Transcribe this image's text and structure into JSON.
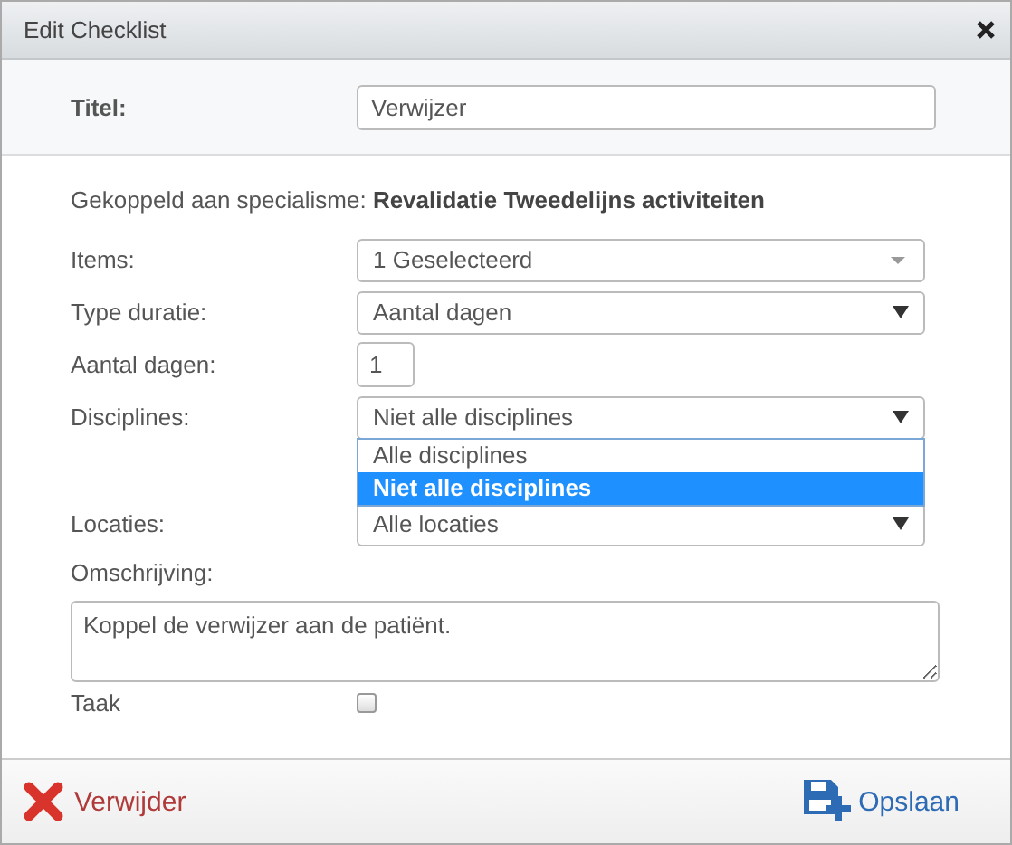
{
  "window": {
    "title": "Edit Checklist"
  },
  "title_field": {
    "label": "Titel:",
    "value": "Verwijzer"
  },
  "linked": "Gekoppeld aan specialisme: **Revalidatie Tweedelijns activiteiten**",
  "fields": [
    {
      "kind": "multiselect",
      "label": "Items:",
      "value": "1 Geselecteerd"
    },
    {
      "kind": "select",
      "label": "Type duratie:",
      "value": "Aantal dagen"
    },
    {
      "kind": "number",
      "label": "Aantal dagen:",
      "value": "1"
    },
    {
      "kind": "select",
      "label": "Disciplines:",
      "value": "Niet alle disciplines",
      "expanded": true,
      "options": [
        {
          "label": "Alle disciplines",
          "selected": false
        },
        {
          "label": "Niet alle disciplines",
          "selected": true
        }
      ]
    },
    {
      "kind": "select",
      "label": "Locaties:",
      "value": "Alle locaties"
    }
  ],
  "description": {
    "label": "Omschrijving:",
    "value": "Koppel de verwijzer aan de patiënt."
  },
  "task": {
    "label": "Taak",
    "checked": false
  },
  "buttons": [
    {
      "kind": "delete",
      "label": "Verwijder"
    },
    {
      "kind": "save",
      "label": "Opslaan"
    }
  ]
}
